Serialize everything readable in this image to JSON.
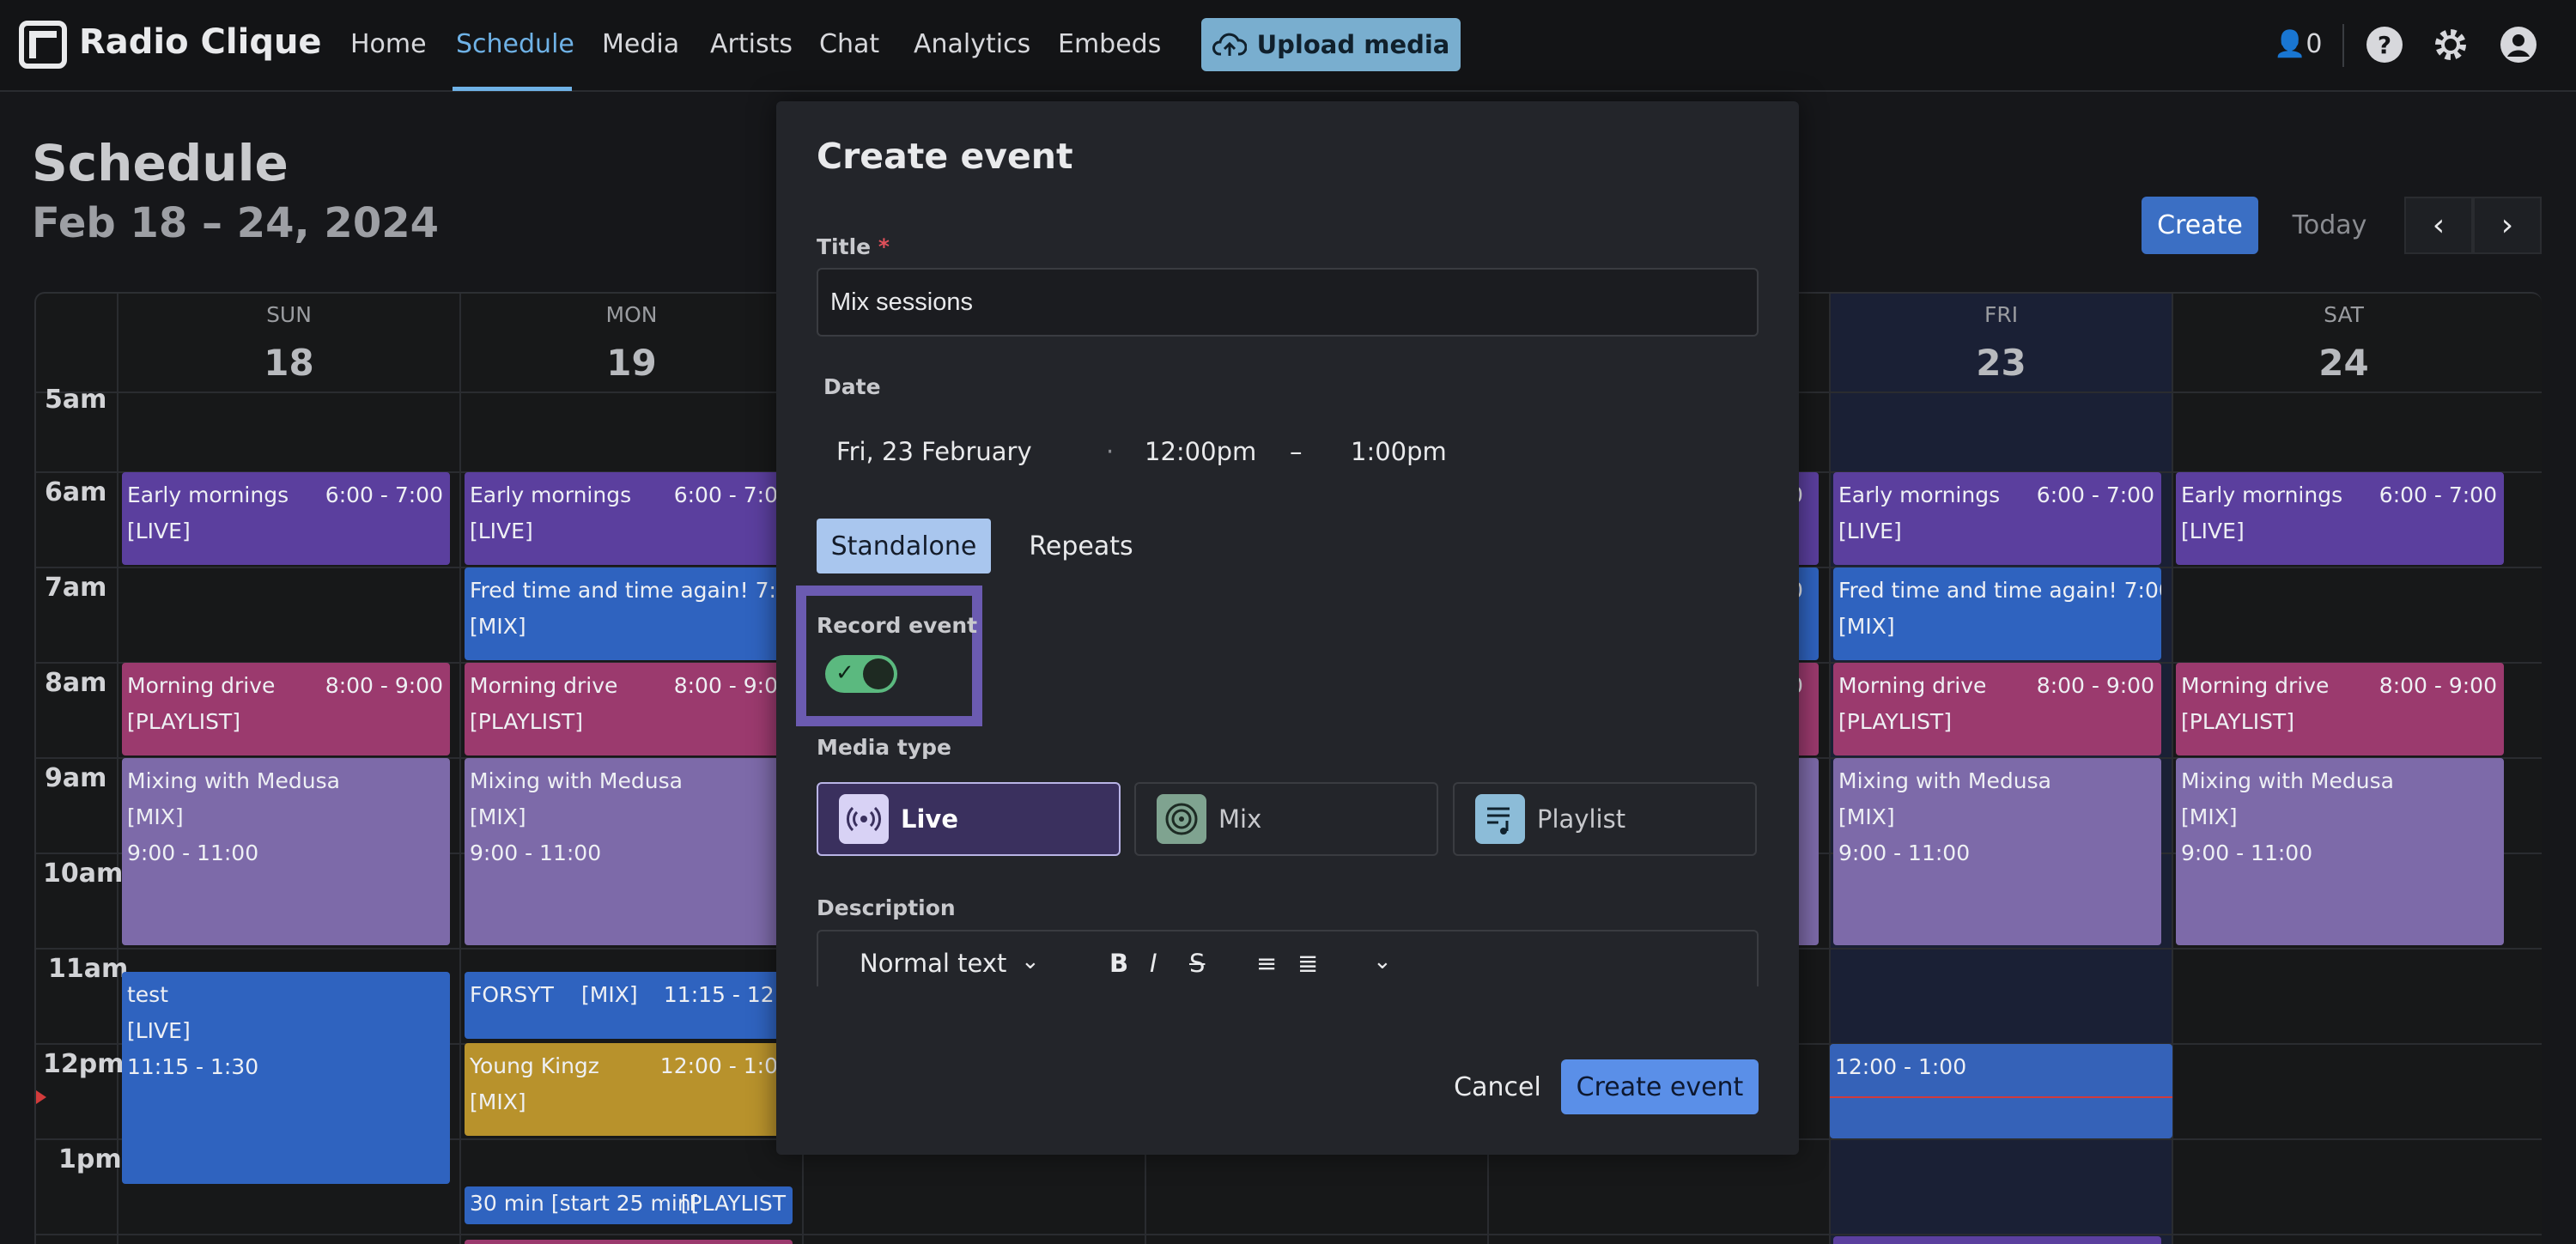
{
  "app": {
    "name": "Radio Clique"
  },
  "nav": {
    "home": "Home",
    "schedule": "Schedule",
    "media": "Media",
    "artists": "Artists",
    "chat": "Chat",
    "analytics": "Analytics",
    "embeds": "Embeds",
    "upload": "Upload media",
    "listeners": "0"
  },
  "schedule": {
    "title": "Schedule",
    "range": "Feb 18 – 24, 2024",
    "create": "Create",
    "today": "Today",
    "days": [
      {
        "name": "SUN",
        "date": "18"
      },
      {
        "name": "MON",
        "date": "19"
      },
      {
        "name": "FRI",
        "date": "23"
      },
      {
        "name": "SAT",
        "date": "24"
      }
    ],
    "hours": [
      "5am",
      "6am",
      "7am",
      "8am",
      "9am",
      "10am",
      "11am",
      "12pm",
      "1pm"
    ],
    "events": {
      "early": {
        "title": "Early mornings",
        "time": "6:00 - 7:00",
        "tag": "[LIVE]"
      },
      "fred": {
        "title": "Fred time and time again!",
        "time": "7:00",
        "tag": "[MIX]"
      },
      "morning": {
        "title": "Morning drive",
        "time": "8:00 - 9:00",
        "tag": "[PLAYLIST]"
      },
      "medusa": {
        "title": "Mixing with Medusa",
        "tag": "[MIX]",
        "time": "9:00 - 11:00"
      },
      "test": {
        "title": "test",
        "tag": "[LIVE]",
        "time": "11:15 - 1:30"
      },
      "forsyt": {
        "title": "FORSYT",
        "tag": "[MIX]",
        "time": "11:15 - 12:0"
      },
      "young": {
        "title": "Young Kingz",
        "time": "12:00 - 1:0",
        "tag": "[MIX]"
      },
      "thirty": {
        "title": "30 min [start 25 min[",
        "tag": "[PLAYLIST"
      },
      "fri_new": {
        "time": "12:00 - 1:00"
      },
      "mon_early_time": "6:00 - 7:0",
      "mon_morning_time": "8:00 - 9:0",
      "partial_time": "0"
    }
  },
  "modal": {
    "title": "Create event",
    "title_label": "Title",
    "required_mark": "*",
    "title_value": "Mix sessions",
    "date_label": "Date",
    "date_value": "Fri, 23 February",
    "sep": "·",
    "start": "12:00pm",
    "dash": "–",
    "end": "1:00pm",
    "standalone": "Standalone",
    "repeats": "Repeats",
    "record_label": "Record event",
    "media_type_label": "Media type",
    "media_types": {
      "live": "Live",
      "mix": "Mix",
      "playlist": "Playlist"
    },
    "description_label": "Description",
    "text_style": "Normal text",
    "cancel": "Cancel",
    "create": "Create event"
  }
}
